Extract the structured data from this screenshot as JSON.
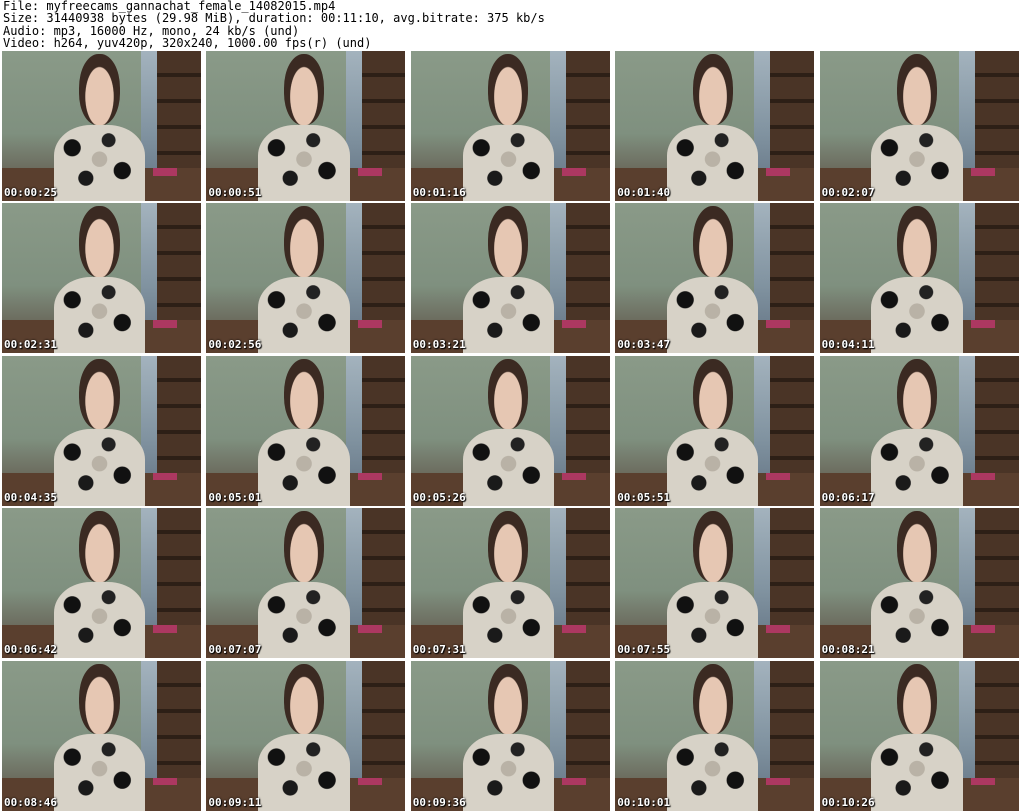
{
  "header": {
    "lines": [
      "File: myfreecams_gannachat_female_14082015.mp4",
      "Size: 31440938 bytes (29.98 MiB), duration: 00:11:10, avg.bitrate: 375 kb/s",
      "Audio: mp3, 16000 Hz, mono, 24 kb/s (und)",
      "Video: h264, yuv420p, 320x240, 1000.00 fps(r) (und)"
    ]
  },
  "thumbnails": [
    {
      "timestamp": "00:00:25"
    },
    {
      "timestamp": "00:00:51"
    },
    {
      "timestamp": "00:01:16"
    },
    {
      "timestamp": "00:01:40"
    },
    {
      "timestamp": "00:02:07"
    },
    {
      "timestamp": "00:02:31"
    },
    {
      "timestamp": "00:02:56"
    },
    {
      "timestamp": "00:03:21"
    },
    {
      "timestamp": "00:03:47"
    },
    {
      "timestamp": "00:04:11"
    },
    {
      "timestamp": "00:04:35"
    },
    {
      "timestamp": "00:05:01"
    },
    {
      "timestamp": "00:05:26"
    },
    {
      "timestamp": "00:05:51"
    },
    {
      "timestamp": "00:06:17"
    },
    {
      "timestamp": "00:06:42"
    },
    {
      "timestamp": "00:07:07"
    },
    {
      "timestamp": "00:07:31"
    },
    {
      "timestamp": "00:07:55"
    },
    {
      "timestamp": "00:08:21"
    },
    {
      "timestamp": "00:08:46"
    },
    {
      "timestamp": "00:09:11"
    },
    {
      "timestamp": "00:09:36"
    },
    {
      "timestamp": "00:10:01"
    },
    {
      "timestamp": "00:10:26"
    }
  ]
}
